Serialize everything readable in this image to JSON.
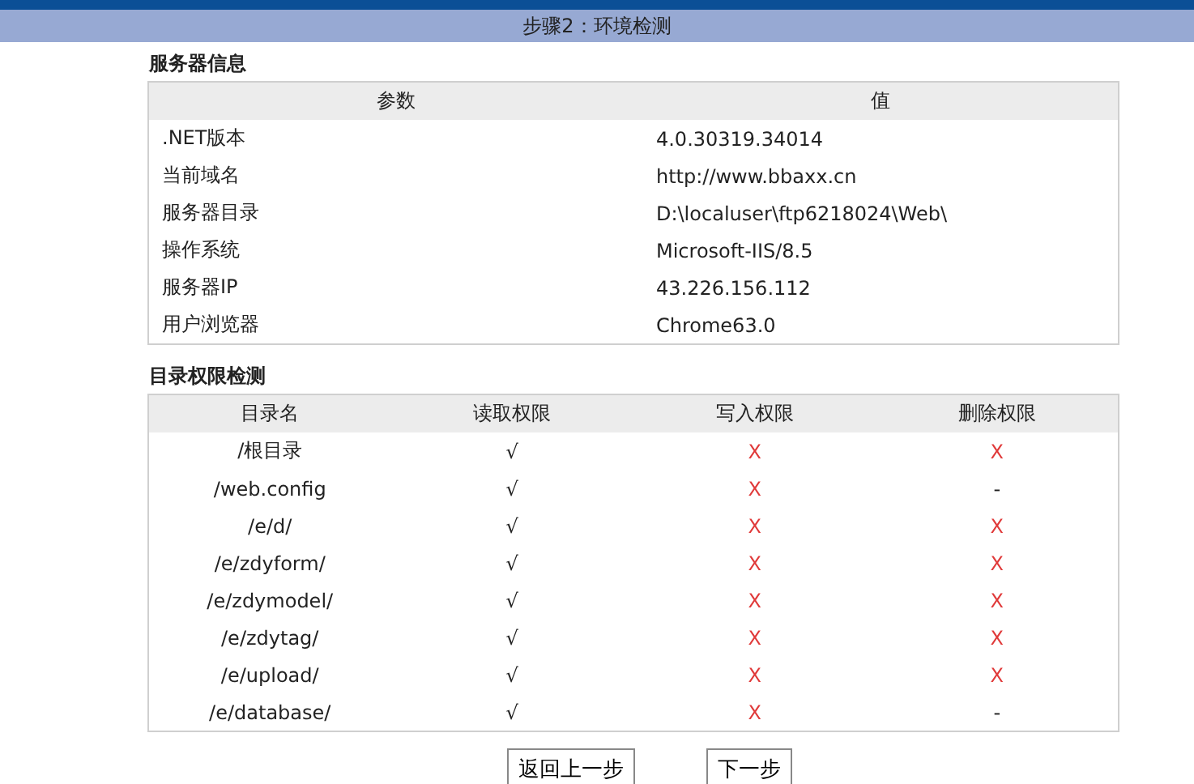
{
  "header": {
    "title": "步骤2：环境检测"
  },
  "server_info": {
    "title": "服务器信息",
    "columns": [
      "参数",
      "值"
    ],
    "rows": [
      {
        "name": ".NET版本",
        "value": "4.0.30319.34014"
      },
      {
        "name": "当前域名",
        "value": "http://www.bbaxx.cn"
      },
      {
        "name": "服务器目录",
        "value": "D:\\localuser\\ftp6218024\\Web\\"
      },
      {
        "name": "操作系统",
        "value": "Microsoft-IIS/8.5"
      },
      {
        "name": "服务器IP",
        "value": "43.226.156.112"
      },
      {
        "name": "用户浏览器",
        "value": "Chrome63.0"
      }
    ]
  },
  "permissions": {
    "title": "目录权限检测",
    "columns": [
      "目录名",
      "读取权限",
      "写入权限",
      "删除权限"
    ],
    "rows": [
      {
        "cells": [
          {
            "kind": "name",
            "text": "/根目录"
          },
          {
            "kind": "ok",
            "text": "√"
          },
          {
            "kind": "fail",
            "text": "X"
          },
          {
            "kind": "fail",
            "text": "X"
          }
        ]
      },
      {
        "cells": [
          {
            "kind": "name",
            "text": "/web.config"
          },
          {
            "kind": "ok",
            "text": "√"
          },
          {
            "kind": "fail",
            "text": "X"
          },
          {
            "kind": "na",
            "text": "-"
          }
        ]
      },
      {
        "cells": [
          {
            "kind": "name",
            "text": "/e/d/"
          },
          {
            "kind": "ok",
            "text": "√"
          },
          {
            "kind": "fail",
            "text": "X"
          },
          {
            "kind": "fail",
            "text": "X"
          }
        ]
      },
      {
        "cells": [
          {
            "kind": "name",
            "text": "/e/zdyform/"
          },
          {
            "kind": "ok",
            "text": "√"
          },
          {
            "kind": "fail",
            "text": "X"
          },
          {
            "kind": "fail",
            "text": "X"
          }
        ]
      },
      {
        "cells": [
          {
            "kind": "name",
            "text": "/e/zdymodel/"
          },
          {
            "kind": "ok",
            "text": "√"
          },
          {
            "kind": "fail",
            "text": "X"
          },
          {
            "kind": "fail",
            "text": "X"
          }
        ]
      },
      {
        "cells": [
          {
            "kind": "name",
            "text": "/e/zdytag/"
          },
          {
            "kind": "ok",
            "text": "√"
          },
          {
            "kind": "fail",
            "text": "X"
          },
          {
            "kind": "fail",
            "text": "X"
          }
        ]
      },
      {
        "cells": [
          {
            "kind": "name",
            "text": "/e/upload/"
          },
          {
            "kind": "ok",
            "text": "√"
          },
          {
            "kind": "fail",
            "text": "X"
          },
          {
            "kind": "fail",
            "text": "X"
          }
        ]
      },
      {
        "cells": [
          {
            "kind": "name",
            "text": "/e/database/"
          },
          {
            "kind": "ok",
            "text": "√"
          },
          {
            "kind": "fail",
            "text": "X"
          },
          {
            "kind": "na",
            "text": "-"
          }
        ]
      }
    ]
  },
  "buttons": [
    "返回上一步",
    "下一步"
  ]
}
